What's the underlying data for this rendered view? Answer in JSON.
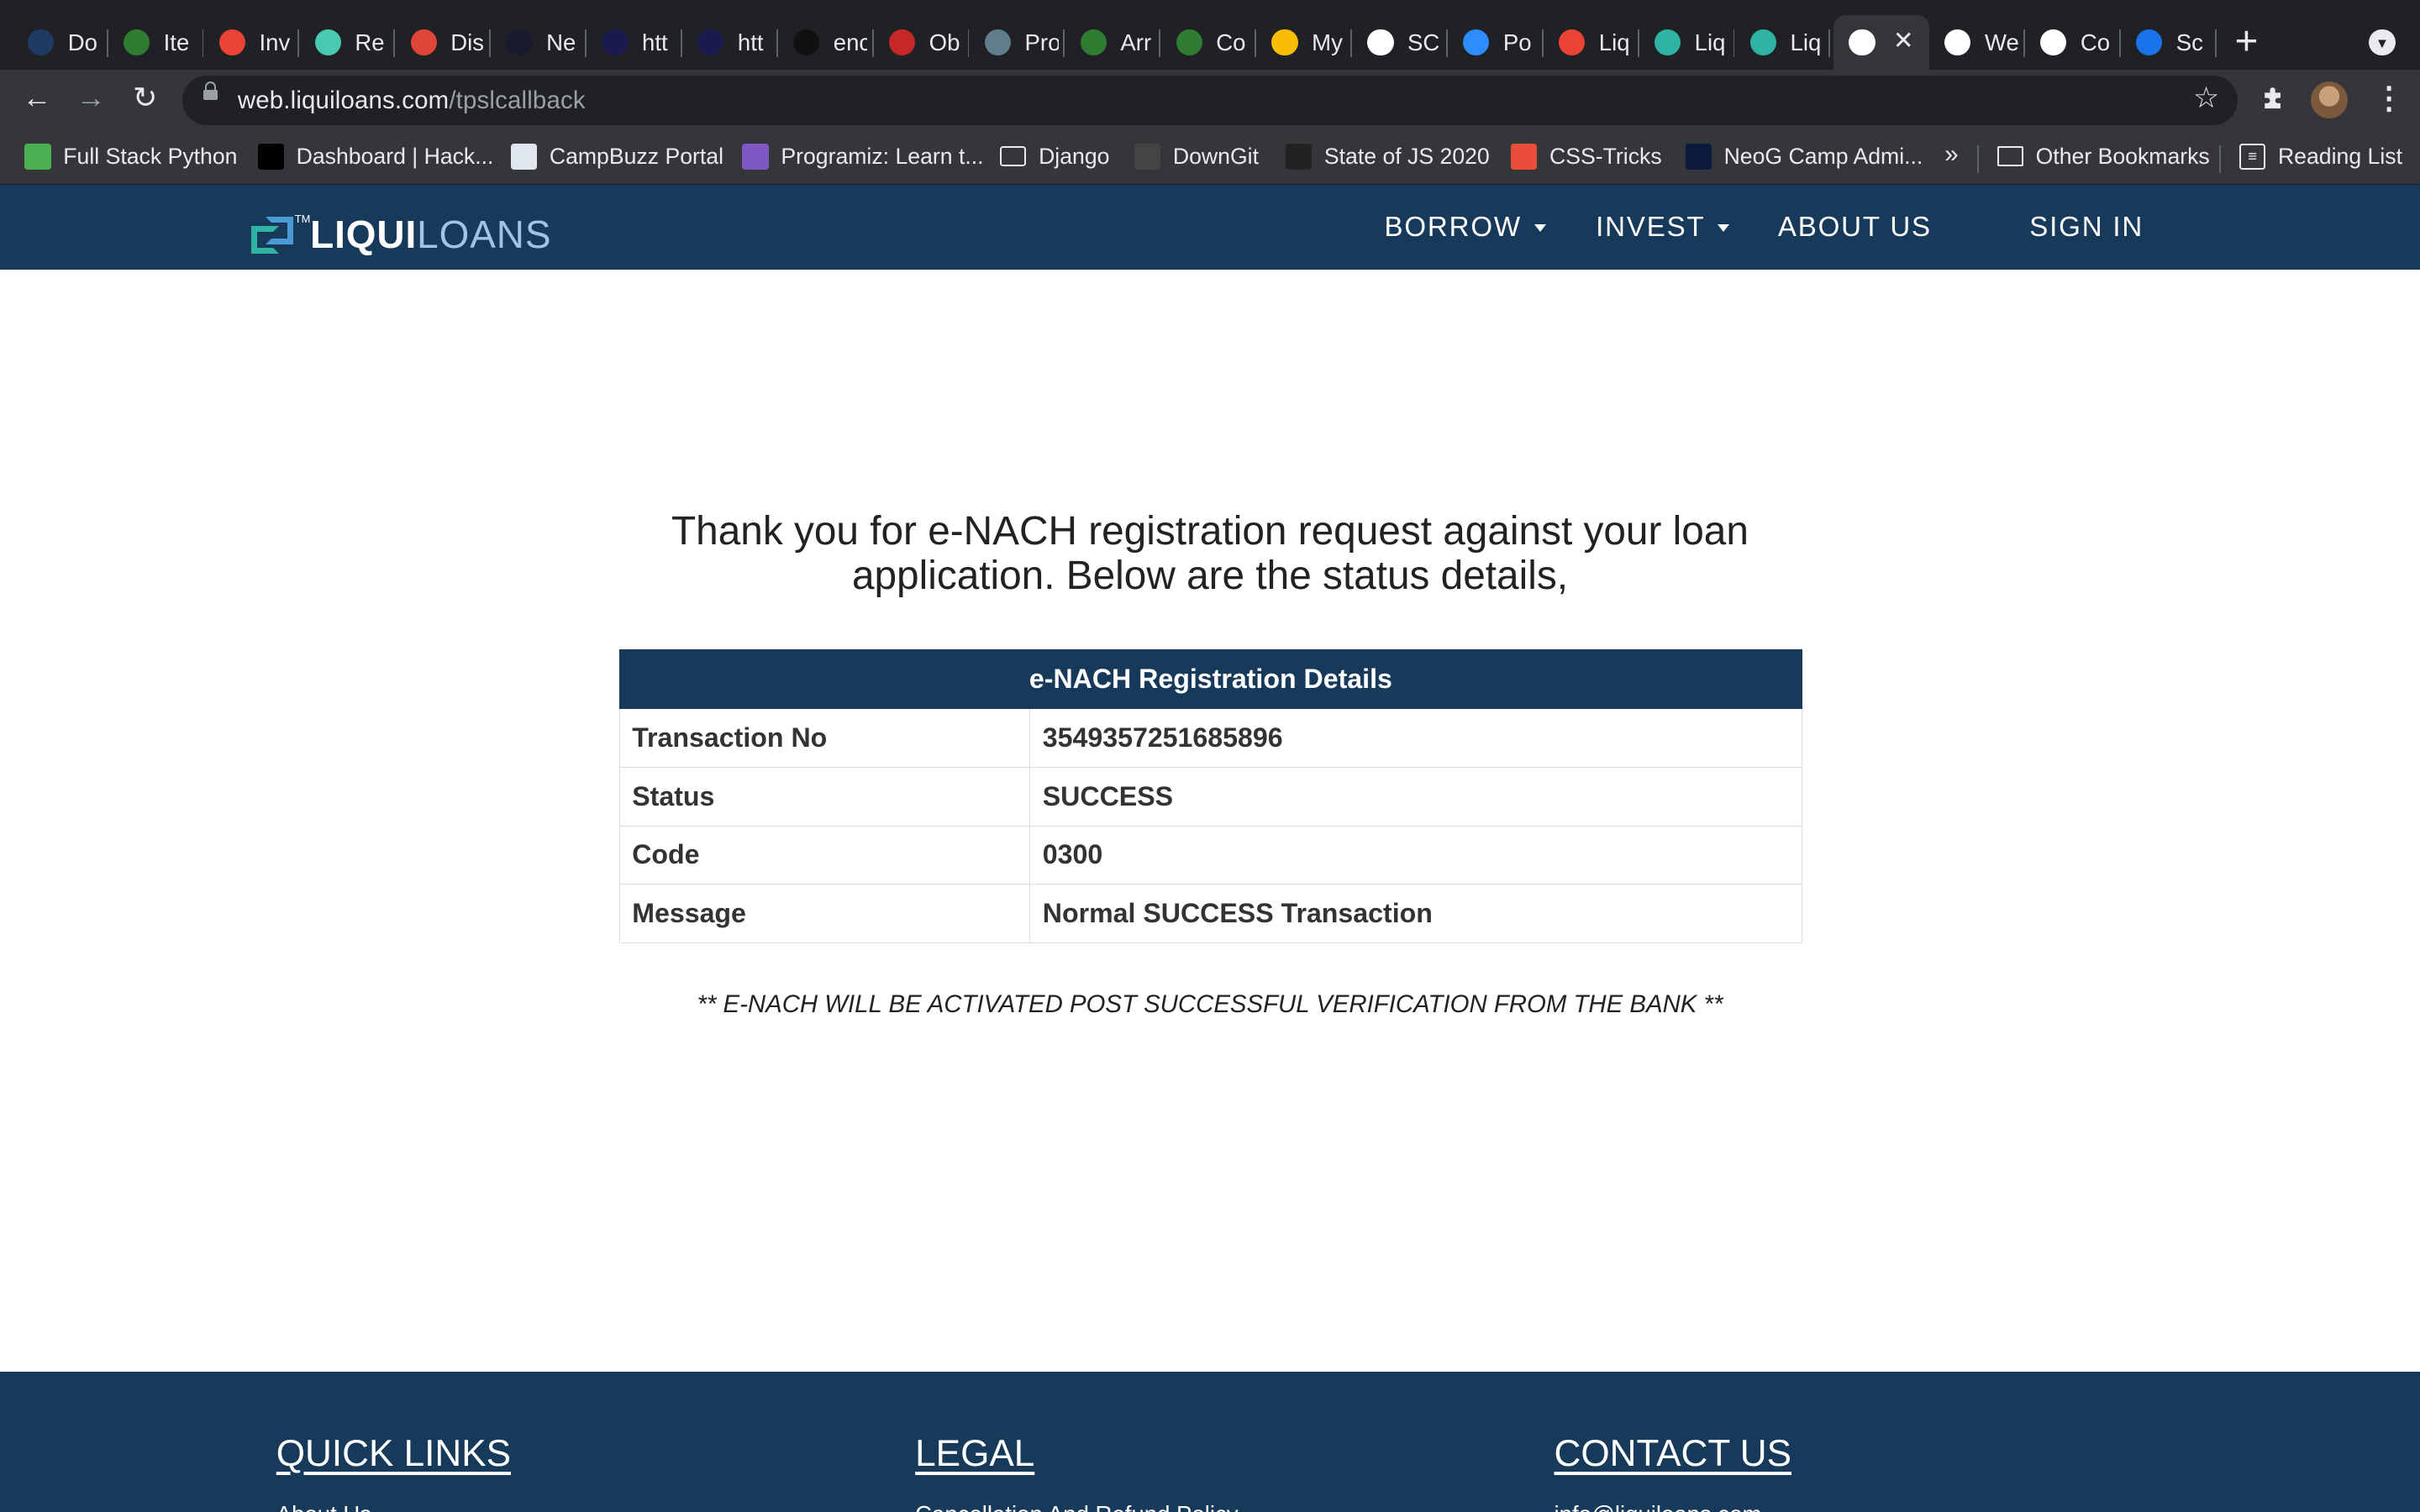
{
  "browser": {
    "tabs": [
      {
        "title": "Do",
        "favicon": "globe-dark-icon",
        "color": "#1f3b63"
      },
      {
        "title": "Ite",
        "favicon": "infinity-icon",
        "color": "#2e7d32"
      },
      {
        "title": "Inv",
        "favicon": "gmail-icon",
        "color": "#ea4335"
      },
      {
        "title": "Re",
        "favicon": "diamond-icon",
        "color": "#48c9b0"
      },
      {
        "title": "Dis",
        "favicon": "calendar-25-icon",
        "color": "#e0453a"
      },
      {
        "title": "Ne",
        "favicon": "neog-n-icon",
        "color": "#1a1a2e"
      },
      {
        "title": "htt",
        "favicon": "neog-logo-icon",
        "color": "#1a1a4e"
      },
      {
        "title": "htt",
        "favicon": "neog-logo-icon",
        "color": "#1a1a4e"
      },
      {
        "title": "enc",
        "favicon": "swirl-icon",
        "color": "#111111"
      },
      {
        "title": "Ob",
        "favicon": "figure-icon",
        "color": "#c62828"
      },
      {
        "title": "Pro",
        "favicon": "mountain-icon",
        "color": "#607d8b"
      },
      {
        "title": "Arr",
        "favicon": "infinity-icon",
        "color": "#2e7d32"
      },
      {
        "title": "Co",
        "favicon": "infinity-icon",
        "color": "#2e7d32"
      },
      {
        "title": "My",
        "favicon": "drive-icon",
        "color": "#fbbc04"
      },
      {
        "title": "SC",
        "favicon": "globe-icon",
        "color": "#ffffff"
      },
      {
        "title": "Po",
        "favicon": "zoom-video-icon",
        "color": "#2d8cff"
      },
      {
        "title": "Liq",
        "favicon": "gmail-icon",
        "color": "#ea4335"
      },
      {
        "title": "Liq",
        "favicon": "liquiloans-icon",
        "color": "#2fb3a3"
      },
      {
        "title": "Liq",
        "favicon": "liquiloans-icon",
        "color": "#2fb3a3"
      },
      {
        "title": "",
        "favicon": "globe-icon",
        "color": "#ffffff",
        "active": true
      },
      {
        "title": "We",
        "favicon": "globe-icon",
        "color": "#ffffff"
      },
      {
        "title": "Co",
        "favicon": "globe-icon",
        "color": "#ffffff"
      },
      {
        "title": "Sc",
        "favicon": "blue-square-icon",
        "color": "#1a73e8"
      }
    ],
    "url_host": "web.liquiloans.com",
    "url_path": "/tpslcallback",
    "bookmarks": [
      {
        "label": "Full Stack Python",
        "icon": "fullstack-icon"
      },
      {
        "label": "Dashboard | Hack...",
        "icon": "hackerrank-icon"
      },
      {
        "label": "CampBuzz Portal",
        "icon": "page-icon"
      },
      {
        "label": "Programiz: Learn t...",
        "icon": "programiz-icon"
      },
      {
        "label": "Django",
        "icon": "folder-icon"
      },
      {
        "label": "DownGit",
        "icon": "downgit-icon"
      },
      {
        "label": "State of JS 2020",
        "icon": "js-icon"
      },
      {
        "label": "CSS-Tricks",
        "icon": "asterisk-icon"
      },
      {
        "label": "NeoG Camp Admi...",
        "icon": "neog-n-icon"
      }
    ],
    "more_bookmarks": "»",
    "other_bookmarks": "Other Bookmarks",
    "reading_list": "Reading List"
  },
  "site": {
    "logo_tm": "TM",
    "logo_bold": "LIQUI",
    "logo_light": "LOANS",
    "nav": {
      "borrow": "BORROW",
      "invest": "INVEST",
      "about": "ABOUT US",
      "signin": "SIGN IN"
    },
    "intro": "Thank you for e-NACH registration request against your loan application. Below are the status details,",
    "table": {
      "header": "e-NACH Registration Details",
      "rows": [
        {
          "label": "Transaction No",
          "value": "3549357251685896"
        },
        {
          "label": "Status",
          "value": "SUCCESS"
        },
        {
          "label": "Code",
          "value": "0300"
        },
        {
          "label": "Message",
          "value": "Normal SUCCESS Transaction"
        }
      ]
    },
    "note": "** E-NACH WILL BE ACTIVATED POST SUCCESSFUL VERIFICATION FROM THE BANK **",
    "footer": {
      "quick_links": "QUICK LINKS",
      "legal": "LEGAL",
      "contact": "CONTACT US",
      "ql_first": "About Us",
      "legal_first": "Cancellation And Refund Policy",
      "contact_first": "info@liquiloans.com"
    }
  }
}
